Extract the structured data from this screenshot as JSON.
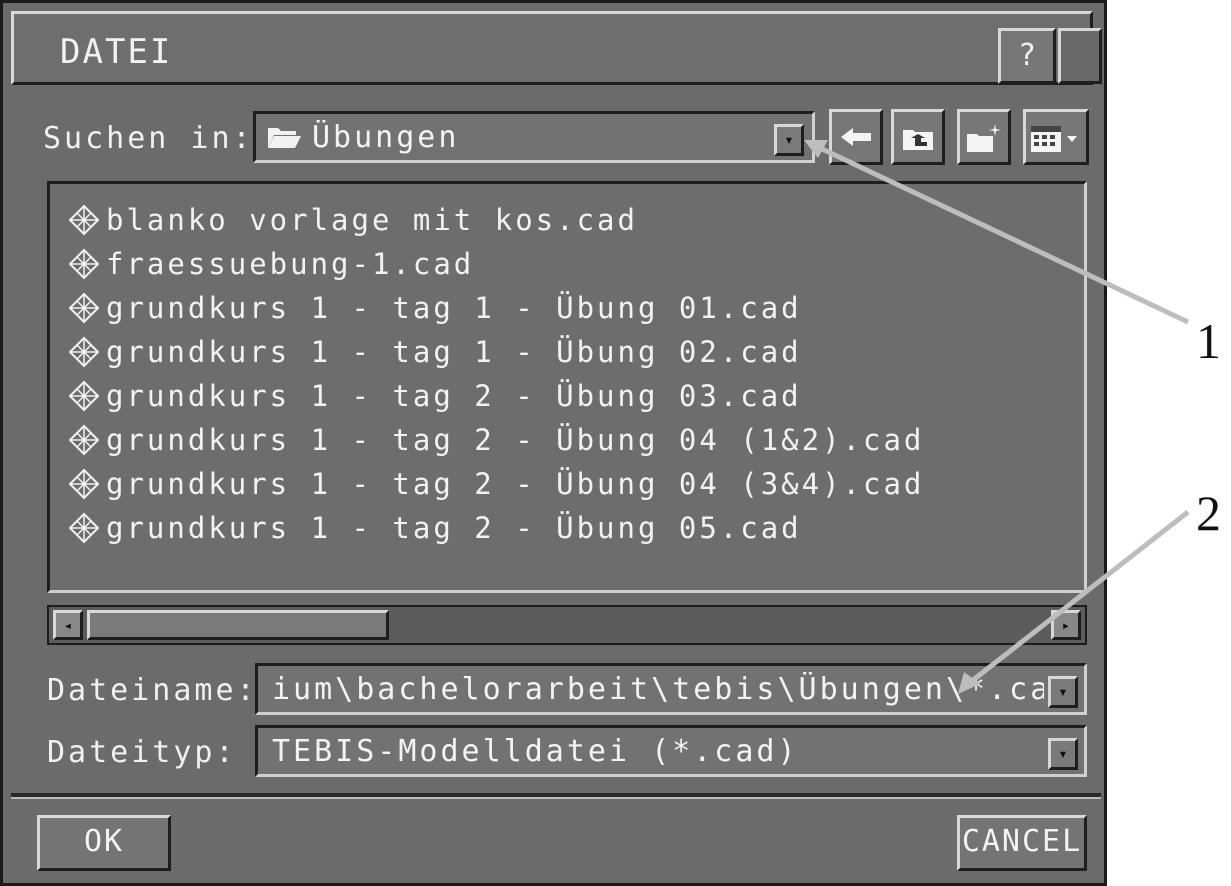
{
  "dialog": {
    "title": "DATEI",
    "help_label": "?"
  },
  "look_in": {
    "label": "Suchen in:",
    "value": "Übungen",
    "icon": "open-folder-icon"
  },
  "toolbar": {
    "back_icon": "back-arrow-icon",
    "up_icon": "folder-up-icon",
    "new_folder_icon": "new-folder-icon",
    "view_icon": "view-menu-icon"
  },
  "files": [
    {
      "name": "blanko vorlage mit kos.cad"
    },
    {
      "name": "fraessuebung-1.cad"
    },
    {
      "name": "grundkurs 1 - tag 1 - Übung 01.cad"
    },
    {
      "name": "grundkurs 1 - tag 1 - Übung 02.cad"
    },
    {
      "name": "grundkurs 1 - tag 2 - Übung 03.cad"
    },
    {
      "name": "grundkurs 1 - tag 2 - Übung 04 (1&2).cad"
    },
    {
      "name": "grundkurs 1 - tag 2 - Übung 04 (3&4).cad"
    },
    {
      "name": "grundkurs 1 - tag 2 - Übung 05.cad"
    }
  ],
  "filename": {
    "label": "Dateiname:",
    "value": "ium\\bachelorarbeit\\tebis\\Übungen\\*.cad"
  },
  "filetype": {
    "label": "Dateityp:",
    "value": "TEBIS-Modelldatei (*.cad)"
  },
  "buttons": {
    "ok": "OK",
    "cancel": "CANCEL"
  },
  "annotations": {
    "callout_1": "1",
    "callout_2": "2"
  },
  "colors": {
    "dialog_bg": "#6b6b6b",
    "text": "#f2f2f2",
    "callout_line": "#bfbfbf"
  }
}
